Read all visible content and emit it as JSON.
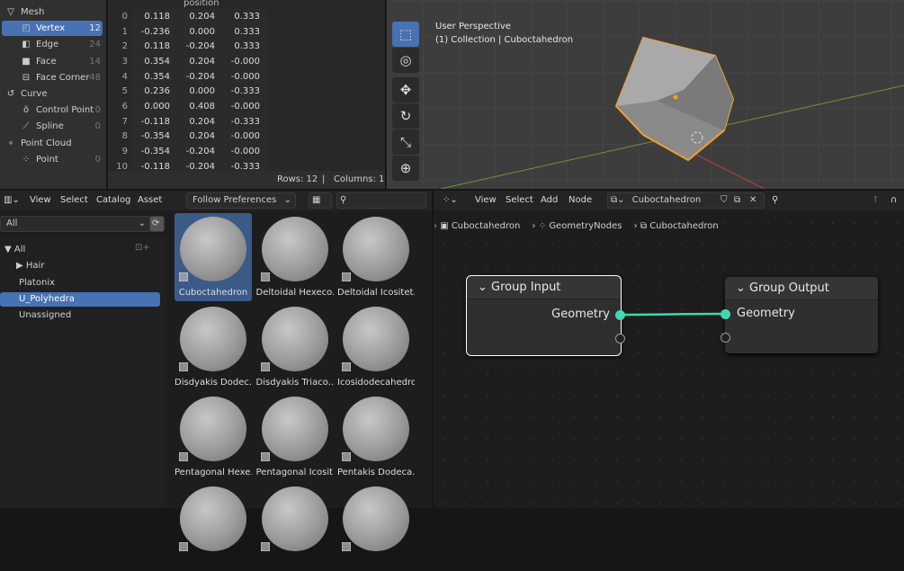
{
  "spreadsheet": {
    "sidebar": [
      {
        "label": "Mesh",
        "icon": "mesh-icon",
        "count": "",
        "level": 0
      },
      {
        "label": "Vertex",
        "icon": "vertex-icon",
        "count": "12",
        "level": 1,
        "selected": true
      },
      {
        "label": "Edge",
        "icon": "edge-icon",
        "count": "24",
        "level": 1
      },
      {
        "label": "Face",
        "icon": "face-icon",
        "count": "14",
        "level": 1
      },
      {
        "label": "Face Corner",
        "icon": "face-corner-icon",
        "count": "48",
        "level": 1
      },
      {
        "label": "Curve",
        "icon": "curve-icon",
        "count": "",
        "level": 0
      },
      {
        "label": "Control Point",
        "icon": "control-point-icon",
        "count": "0",
        "level": 1
      },
      {
        "label": "Spline",
        "icon": "spline-icon",
        "count": "0",
        "level": 1
      },
      {
        "label": "Point Cloud",
        "icon": "point-cloud-icon",
        "count": "",
        "level": 0
      },
      {
        "label": "Point",
        "icon": "point-icon",
        "count": "0",
        "level": 1
      }
    ],
    "column_header": "position",
    "rows": [
      [
        "0",
        "0.118",
        "0.204",
        "0.333"
      ],
      [
        "1",
        "-0.236",
        "0.000",
        "0.333"
      ],
      [
        "2",
        "0.118",
        "-0.204",
        "0.333"
      ],
      [
        "3",
        "0.354",
        "0.204",
        "-0.000"
      ],
      [
        "4",
        "0.354",
        "-0.204",
        "-0.000"
      ],
      [
        "5",
        "0.236",
        "0.000",
        "-0.333"
      ],
      [
        "6",
        "0.000",
        "0.408",
        "-0.000"
      ],
      [
        "7",
        "-0.118",
        "0.204",
        "-0.333"
      ],
      [
        "8",
        "-0.354",
        "0.204",
        "-0.000"
      ],
      [
        "9",
        "-0.354",
        "-0.204",
        "-0.000"
      ],
      [
        "10",
        "-0.118",
        "-0.204",
        "-0.333"
      ]
    ],
    "status": {
      "rows": "Rows: 12",
      "sep": "|",
      "columns": "Columns: 1"
    }
  },
  "viewport": {
    "title": "User Perspective",
    "subtitle": "(1) Collection | Cuboctahedron",
    "tools": [
      "select-box-icon",
      "cursor-icon",
      "move-icon",
      "rotate-icon",
      "scale-icon",
      "transform-icon"
    ],
    "outline_color": "#f0a030"
  },
  "asset_browser": {
    "menus": [
      "View",
      "Select",
      "Catalog",
      "Asset"
    ],
    "import_method": "Follow Preferences",
    "library": "All",
    "tree": [
      {
        "label": "All",
        "arrow": "▼"
      },
      {
        "label": "Hair",
        "arrow": "▶"
      },
      {
        "label": "Platonix"
      },
      {
        "label": "U_Polyhedra",
        "selected": true
      },
      {
        "label": "Unassigned"
      }
    ],
    "assets": [
      "Cuboctahedron",
      "Deltoidal Hexeco...",
      "Deltoidal Icositet...",
      "Disdyakis Dodec...",
      "Disdyakis Triaco...",
      "Icosidodecahedron",
      "Pentagonal Hexe...",
      "Pentagonal Icosit...",
      "Pentakis Dodeca...",
      "",
      "",
      ""
    ]
  },
  "node_editor": {
    "menus": [
      "View",
      "Select",
      "Add",
      "Node"
    ],
    "node_tree": "Cuboctahedron",
    "breadcrumb": [
      "Cuboctahedron",
      "GeometryNodes",
      "Cuboctahedron"
    ],
    "nodes": {
      "input": {
        "title": "Group Input",
        "socket": "Geometry"
      },
      "output": {
        "title": "Group Output",
        "socket": "Geometry"
      }
    },
    "link_color": "#3fd8b0"
  }
}
